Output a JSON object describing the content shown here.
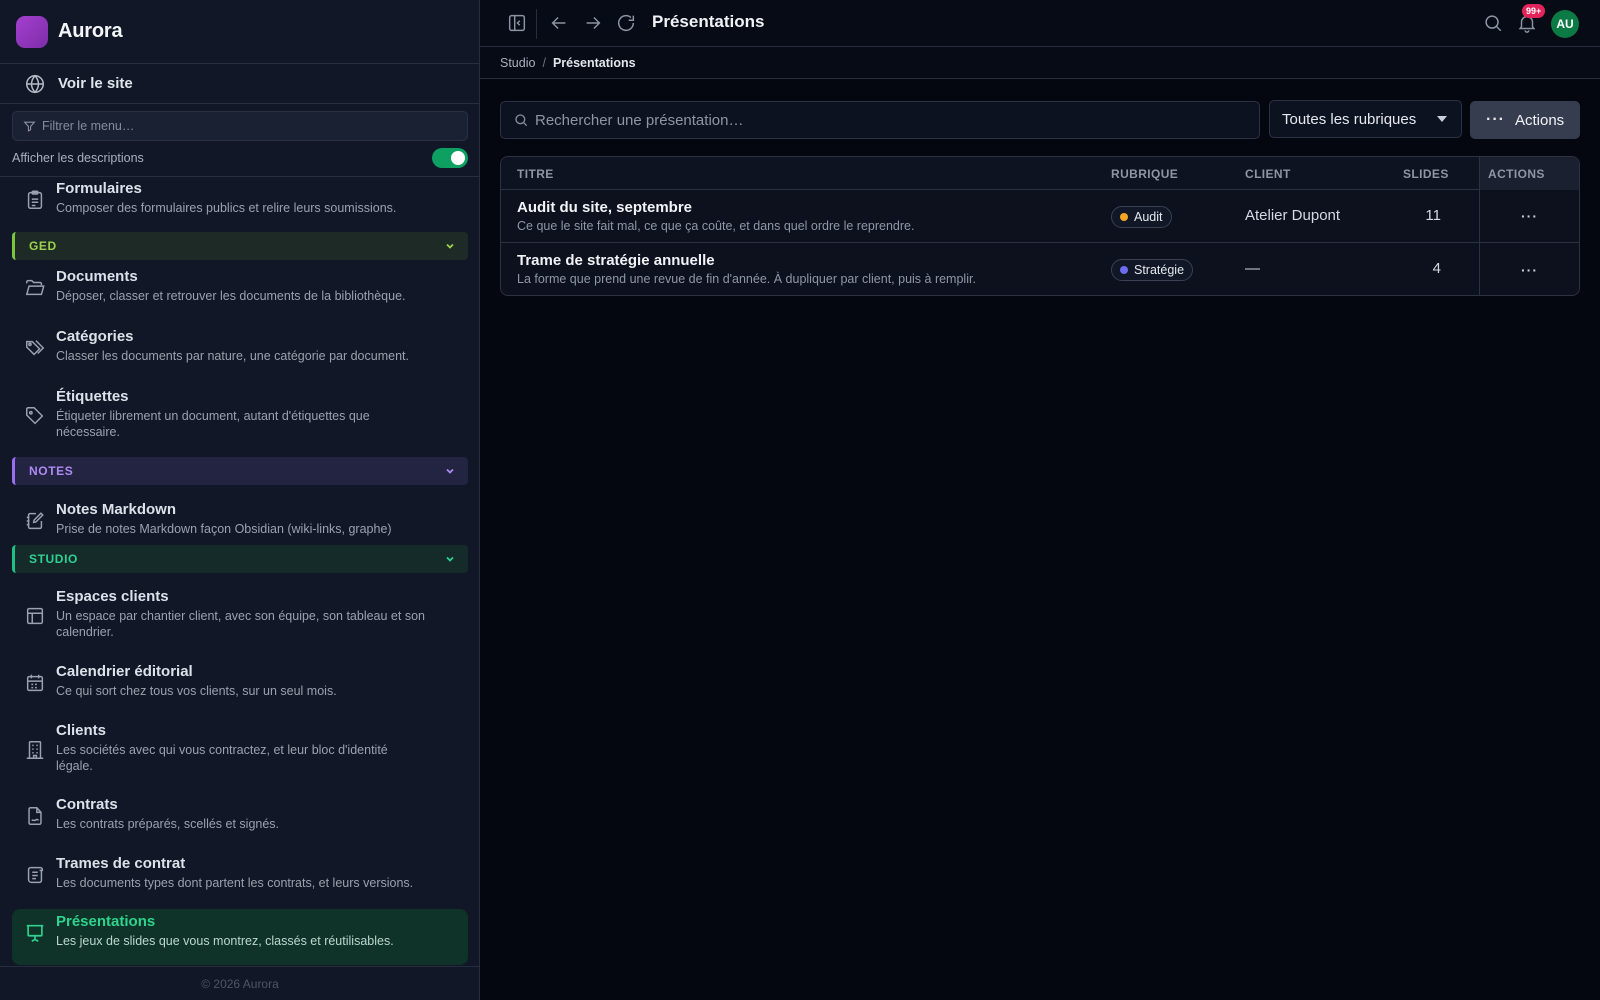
{
  "brand": {
    "name": "Aurora"
  },
  "sidebar": {
    "visit_label": "Voir le site",
    "filter_placeholder": "Filtrer le menu…",
    "show_descriptions_label": "Afficher les descriptions",
    "show_descriptions_on": true,
    "items": [
      {
        "title": "Formulaires",
        "desc": "Composer des formulaires publics et relire leurs soumissions.",
        "icon": "clipboard-icon"
      },
      {
        "title": "Documents",
        "desc": "Déposer, classer et retrouver les documents de la bibliothèque.",
        "icon": "folder-open-icon"
      },
      {
        "title": "Catégories",
        "desc": "Classer les documents par nature, une catégorie par document.",
        "icon": "tags-icon"
      },
      {
        "title": "Étiquettes",
        "desc": "Étiqueter librement un document, autant d'étiquettes que nécessaire.",
        "icon": "tag-icon"
      },
      {
        "title": "Notes Markdown",
        "desc": "Prise de notes Markdown façon Obsidian (wiki-links, graphe)",
        "icon": "notebook-pen-icon"
      },
      {
        "title": "Espaces clients",
        "desc": "Un espace par chantier client, avec son équipe, son tableau et son calendrier.",
        "icon": "layout-icon"
      },
      {
        "title": "Calendrier éditorial",
        "desc": "Ce qui sort chez tous vos clients, sur un seul mois.",
        "icon": "calendar-icon"
      },
      {
        "title": "Clients",
        "desc": "Les sociétés avec qui vous contractez, et leur bloc d'identité légale.",
        "icon": "building-icon"
      },
      {
        "title": "Contrats",
        "desc": "Les contrats préparés, scellés et signés.",
        "icon": "file-signature-icon"
      },
      {
        "title": "Trames de contrat",
        "desc": "Les documents types dont partent les contrats, et leurs versions.",
        "icon": "scroll-icon"
      },
      {
        "title": "Présentations",
        "desc": "Les jeux de slides que vous montrez, classés et réutilisables.",
        "icon": "presentation-icon",
        "active": true
      }
    ],
    "sections": {
      "ged": "GED",
      "notes": "NOTES",
      "studio": "STUDIO"
    },
    "footer": "© 2026 Aurora"
  },
  "topbar": {
    "title": "Présentations",
    "notifications_badge": "99+",
    "avatar_initials": "AU"
  },
  "breadcrumb": {
    "parent": "Studio",
    "separator": "/",
    "current": "Présentations"
  },
  "toolbar": {
    "search_placeholder": "Rechercher une présentation…",
    "filter_value": "Toutes les rubriques",
    "actions_label": "Actions"
  },
  "table": {
    "columns": {
      "title": "TITRE",
      "rubric": "RUBRIQUE",
      "client": "CLIENT",
      "slides": "SLIDES",
      "actions": "ACTIONS"
    },
    "rows": [
      {
        "title": "Audit du site, septembre",
        "subtitle": "Ce que le site fait mal, ce que ça coûte, et dans quel ordre le reprendre.",
        "rubric": "Audit",
        "rubric_color": "#f5a524",
        "client": "Atelier Dupont",
        "slides": "11"
      },
      {
        "title": "Trame de stratégie annuelle",
        "subtitle": "La forme que prend une revue de fin d'année. À dupliquer par client, puis à remplir.",
        "rubric": "Stratégie",
        "rubric_color": "#6c6cf0",
        "client": "—",
        "slides": "4"
      }
    ]
  }
}
